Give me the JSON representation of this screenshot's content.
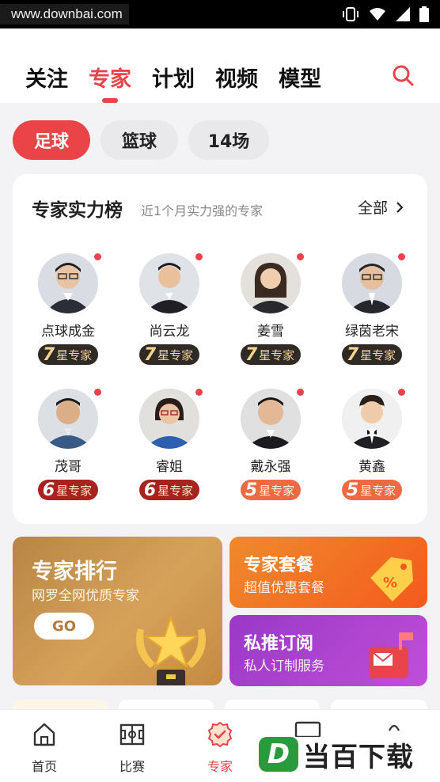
{
  "status_bar": {
    "watermark": "www.downbai.com"
  },
  "top_tabs": [
    {
      "label": "关注"
    },
    {
      "label": "专家"
    },
    {
      "label": "计划"
    },
    {
      "label": "视频"
    },
    {
      "label": "模型"
    }
  ],
  "active_top_tab": "专家",
  "sport_filters": [
    {
      "label": "足球"
    },
    {
      "label": "篮球"
    },
    {
      "label": "14场"
    }
  ],
  "active_sport": "足球",
  "ranking": {
    "title": "专家实力榜",
    "subtitle": "近1个月实力强的专家",
    "view_all": "全部",
    "experts": [
      {
        "name": "点球成金",
        "star": "7",
        "badge_text": "星专家"
      },
      {
        "name": "尚云龙",
        "star": "7",
        "badge_text": "星专家"
      },
      {
        "name": "姜雪",
        "star": "7",
        "badge_text": "星专家"
      },
      {
        "name": "绿茵老宋",
        "star": "7",
        "badge_text": "星专家"
      },
      {
        "name": "茂哥",
        "star": "6",
        "badge_text": "星专家"
      },
      {
        "name": "睿姐",
        "star": "6",
        "badge_text": "星专家"
      },
      {
        "name": "戴永强",
        "star": "5",
        "badge_text": "星专家"
      },
      {
        "name": "黄鑫",
        "star": "5",
        "badge_text": "星专家"
      }
    ]
  },
  "promos": {
    "ranking": {
      "title": "专家排行",
      "subtitle": "网罗全网优质专家",
      "button": "GO"
    },
    "package": {
      "title": "专家套餐",
      "subtitle": "超值优惠套餐"
    },
    "private": {
      "title": "私推订阅",
      "subtitle": "私人订制服务"
    }
  },
  "bottom_nav": [
    {
      "label": "首页",
      "icon": "home-icon"
    },
    {
      "label": "比赛",
      "icon": "match-icon"
    },
    {
      "label": "专家",
      "icon": "expert-badge-icon"
    }
  ],
  "active_bottom_tab": "专家",
  "brand_watermark": {
    "letter": "D",
    "text": "当百下载"
  },
  "colors": {
    "accent": "#e8454b",
    "gold": "#c58a42",
    "orange": "#f45a1e",
    "purple": "#b044cf"
  }
}
